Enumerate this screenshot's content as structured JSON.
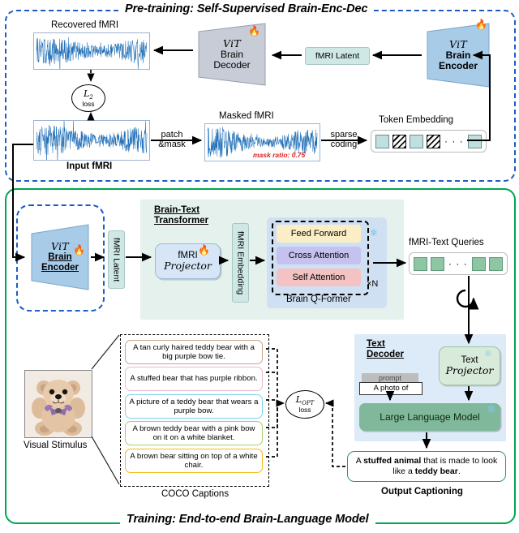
{
  "stages": {
    "pretraining_title": "Pre-training: Self-Supervised Brain-Enc-Dec",
    "training_title": "Training: End-to-end Brain-Language Model"
  },
  "pretraining": {
    "recovered_label": "Recovered fMRI",
    "input_label": "Input fMRI",
    "masked_label": "Masked fMRI",
    "mask_ratio": "mask ratio: 0.75",
    "token_embedding_label": "Token Embedding",
    "fmri_latent_label": "fMRI Latent",
    "brain_decoder": {
      "vit": "ViT",
      "name_line1": "Brain",
      "name_line2": "Decoder",
      "flame": "🔥"
    },
    "brain_encoder": {
      "vit": "ViT",
      "name_line1": "Brain",
      "name_line2": "Encoder",
      "flame": "🔥"
    },
    "arrow_patch_mask_line1": "patch",
    "arrow_patch_mask_line2": "&mask",
    "arrow_sparse_line1": "sparse",
    "arrow_sparse_line2": "coding",
    "l2_loss": {
      "symbol": "L",
      "subscript": "2",
      "word": "loss"
    },
    "token_cells": [
      "plain",
      "hatch",
      "plain",
      "hatch",
      "dots",
      "plain"
    ]
  },
  "training": {
    "brain_encoder": {
      "vit": "ViT",
      "name_line1": "Brain",
      "name_line2": "Encoder",
      "flame": "🔥"
    },
    "fmri_latent_label": "fMRI Latent",
    "brain_text_transformer_line1": "Brain-Text",
    "brain_text_transformer_line2": "Transformer",
    "fmri_projector_line1": "fMRI",
    "fmri_projector_line2": "Projector",
    "fmri_projector_flame": "🔥",
    "fmri_embedding_label": "fMRI Embedding",
    "qformer": {
      "rows": [
        {
          "label": "Feed Forward",
          "color": "#fbeec6"
        },
        {
          "label": "Cross Attention",
          "color": "#c5c2ef"
        },
        {
          "label": "Self Attention",
          "color": "#f3c3c3"
        }
      ],
      "repeat": "×N",
      "caption": "Brain Q-Former",
      "snowflake": "❄"
    },
    "queries_label": "fMRI-Text Queries",
    "query_cells": [
      "g",
      "g",
      "dots",
      "g",
      "g"
    ]
  },
  "captions_block": {
    "visual_stimulus_label": "Visual Stimulus",
    "coco_label": "COCO Captions",
    "items": [
      {
        "text": "A tan curly haired teddy bear with a big purple bow tie.",
        "border": "#c8a58a"
      },
      {
        "text": "A stuffed bear that has  purple ribbon.",
        "border": "#e8b9d2"
      },
      {
        "text": "A picture of a teddy bear that wears a purple bow.",
        "border": "#7fd4e8"
      },
      {
        "text": "A brown teddy bear with a pink bow on it on a white blanket.",
        "border": "#a9ce6a"
      },
      {
        "text": "A brown bear sitting on top of a white chair.",
        "border": "#f5b915"
      }
    ],
    "opt_loss": {
      "symbol": "L",
      "subscript": "OPT",
      "word": "loss"
    }
  },
  "text_decoder": {
    "title_line1": "Text",
    "title_line2": "Decoder",
    "prompt_label": "prompt",
    "prompt_value": "A photo of",
    "text_projector_line1": "Text",
    "text_projector_line2": "Projector",
    "projector_snowflake": "❄",
    "llm_label": "Large Language Model",
    "llm_snowflake": "❄",
    "output_caption_html": "A <b>stuffed animal</b> that is made to look like a <b>teddy bear</b>.",
    "output_caption_label": "Output Captioning"
  },
  "colors": {
    "pretrain_frame": "#1f5bc4",
    "training_frame": "#00a651",
    "signal_blue": "#2170b8",
    "encoder_fill": "#a8cbe8",
    "decoder_fill": "#c7ccd6",
    "tag_fill": "#cfe8e6",
    "mask_ratio_red": "#e02020"
  }
}
